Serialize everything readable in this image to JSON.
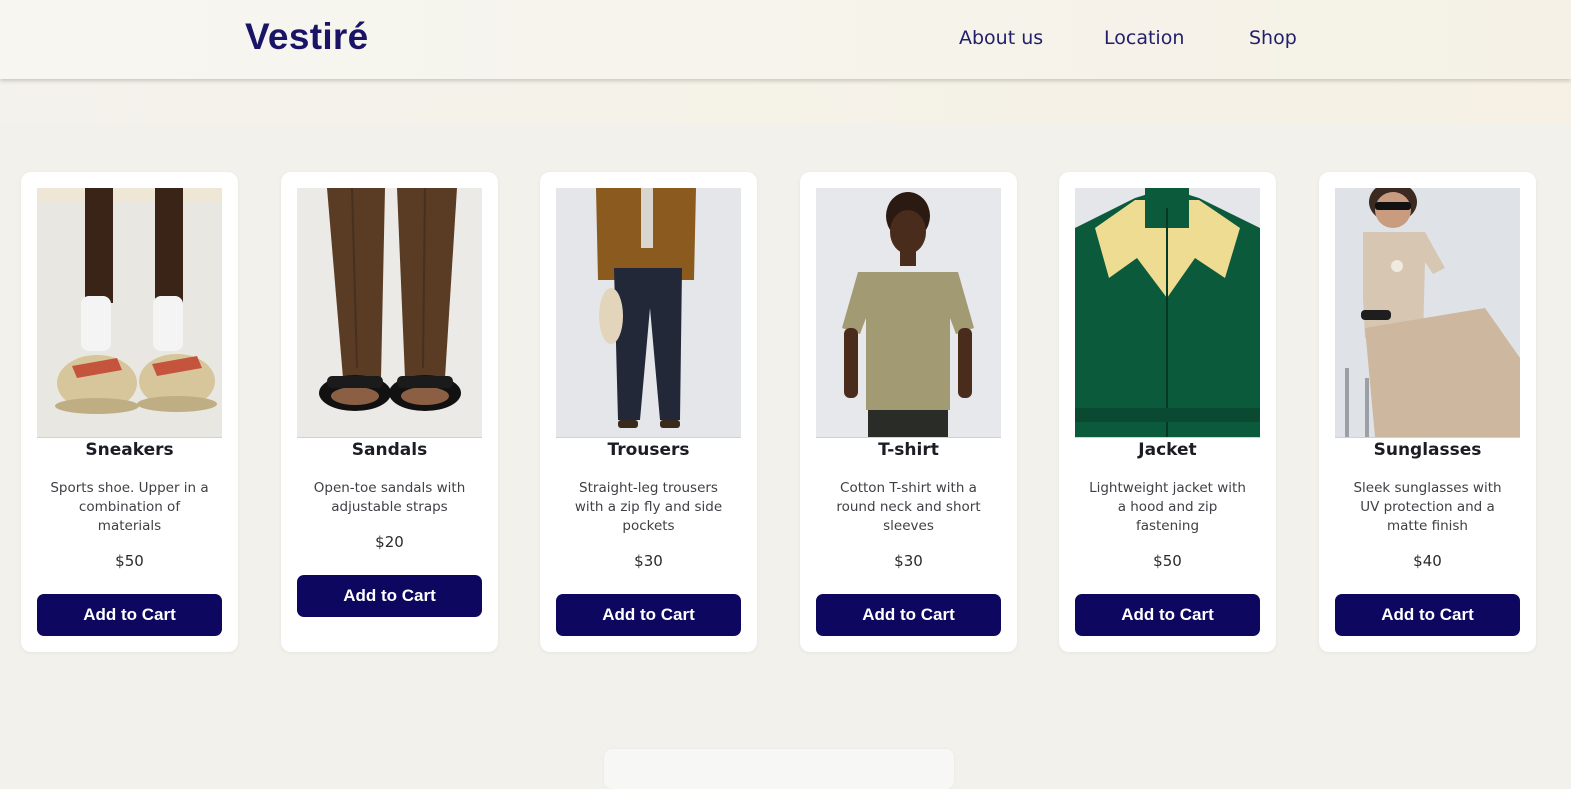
{
  "brand": {
    "logo": "Vestiré",
    "color": "#1a1466"
  },
  "nav": [
    {
      "label": "About us"
    },
    {
      "label": "Location"
    },
    {
      "label": "Shop"
    }
  ],
  "products": [
    {
      "name": "Sneakers",
      "description": "Sports shoe. Upper in a combination of materials",
      "price": "$50",
      "button": "Add to Cart",
      "image_icon": "sneakers-photo"
    },
    {
      "name": "Sandals",
      "description": "Open-toe sandals with adjustable straps",
      "price": "$20",
      "button": "Add to Cart",
      "image_icon": "sandals-photo"
    },
    {
      "name": "Trousers",
      "description": "Straight-leg trousers with a zip fly and side pockets",
      "price": "$30",
      "button": "Add to Cart",
      "image_icon": "trousers-photo"
    },
    {
      "name": "T-shirt",
      "description": "Cotton T-shirt with a round neck and short sleeves",
      "price": "$30",
      "button": "Add to Cart",
      "image_icon": "tshirt-photo"
    },
    {
      "name": "Jacket",
      "description": "Lightweight jacket with a hood and zip fastening",
      "price": "$50",
      "button": "Add to Cart",
      "image_icon": "jacket-photo"
    },
    {
      "name": "Sunglasses",
      "description": "Sleek sunglasses with UV protection and a matte finish",
      "price": "$40",
      "button": "Add to Cart",
      "image_icon": "sunglasses-photo"
    }
  ],
  "colors": {
    "accent": "#0d0760",
    "page_bg": "#f3f1ec",
    "card_bg": "#ffffff"
  }
}
